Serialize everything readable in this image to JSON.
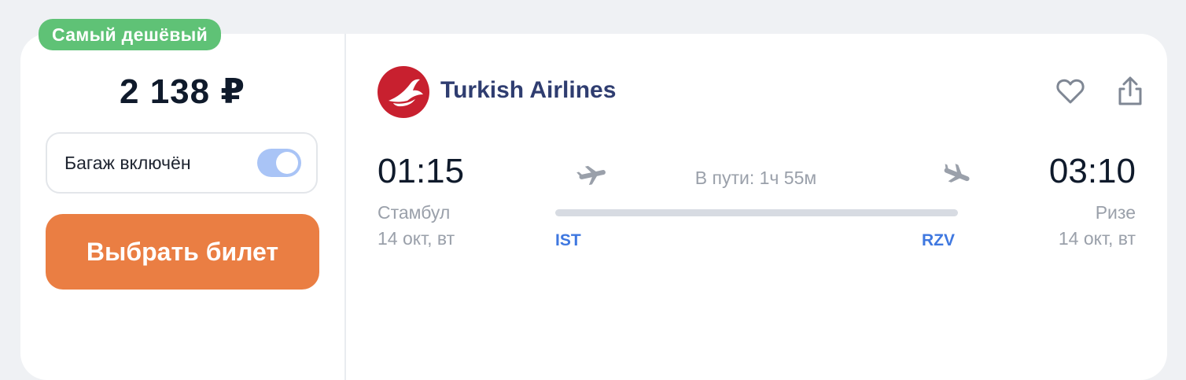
{
  "badge": {
    "label": "Самый дешёвый",
    "color": "#5fc276"
  },
  "price": {
    "amount": "2 138 ₽"
  },
  "baggage": {
    "label": "Багаж включён",
    "toggle_on": true
  },
  "action": {
    "select_label": "Выбрать билет",
    "color": "#ea7e43"
  },
  "airline": {
    "name": "Turkish Airlines",
    "logo_icon": "turkish-airlines-logo",
    "brand_color": "#c8202f"
  },
  "header_icons": {
    "favorite_icon": "heart-icon",
    "share_icon": "share-icon"
  },
  "flight": {
    "departure": {
      "time": "01:15",
      "city": "Стамбул",
      "date": "14 окт, вт",
      "code": "IST"
    },
    "arrival": {
      "time": "03:10",
      "city": "Ризе",
      "date": "14 окт, вт",
      "code": "RZV"
    },
    "duration": "В пути: 1ч 55м",
    "departure_icon": "plane-takeoff-icon",
    "arrival_icon": "plane-landing-icon",
    "code_color": "#3f78e0"
  }
}
